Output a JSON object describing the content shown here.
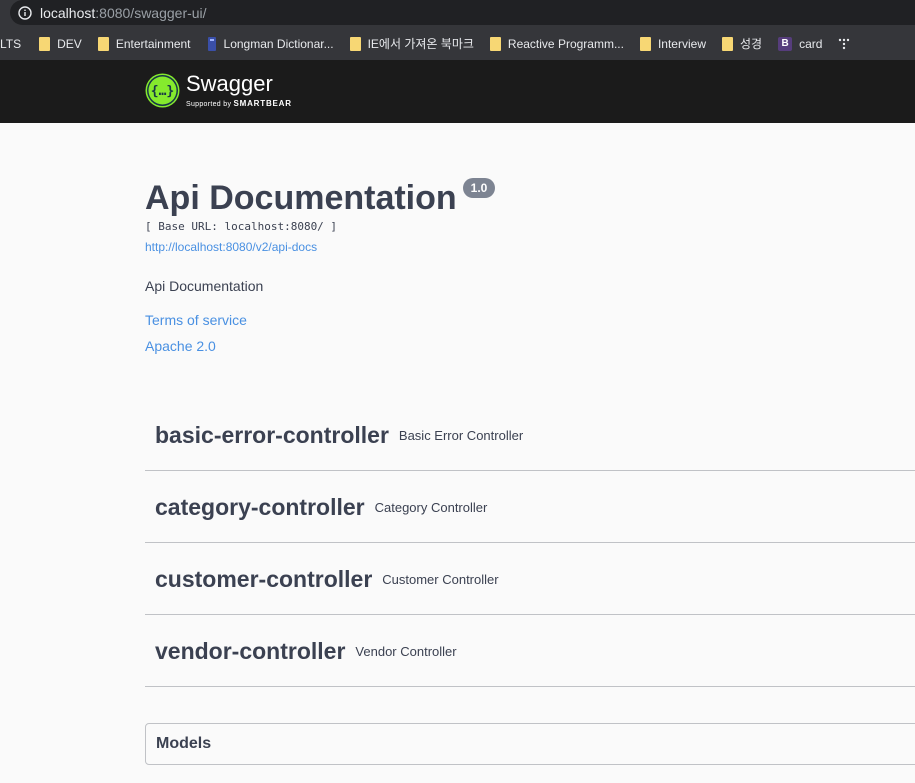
{
  "browser": {
    "url_host": "localhost",
    "url_rest": ":8080/swagger-ui/",
    "bookmarks": [
      {
        "label": "ELTS",
        "icon": "none"
      },
      {
        "label": "DEV",
        "icon": "folder-icon"
      },
      {
        "label": "Entertainment",
        "icon": "folder-icon"
      },
      {
        "label": "Longman Dictionar...",
        "icon": "longman-icon"
      },
      {
        "label": "IE에서 가져온 북마크",
        "icon": "folder-icon"
      },
      {
        "label": "Reactive Programm...",
        "icon": "folder-icon"
      },
      {
        "label": "Interview",
        "icon": "folder-icon"
      },
      {
        "label": "성경",
        "icon": "folder-icon"
      },
      {
        "label": "card",
        "icon": "bootstrap-icon"
      }
    ]
  },
  "topbar": {
    "logo_title": "Swagger",
    "logo_sub_prefix": "Supported by",
    "logo_sub_brand": "SMARTBEAR"
  },
  "info": {
    "title": "Api Documentation",
    "version": "1.0",
    "base_url": "[ Base URL: localhost:8080/ ]",
    "spec_link": "http://localhost:8080/v2/api-docs",
    "description": "Api Documentation",
    "terms": "Terms of service",
    "license": "Apache 2.0"
  },
  "tags": [
    {
      "name": "basic-error-controller",
      "description": "Basic Error Controller"
    },
    {
      "name": "category-controller",
      "description": "Category Controller"
    },
    {
      "name": "customer-controller",
      "description": "Customer Controller"
    },
    {
      "name": "vendor-controller",
      "description": "Vendor Controller"
    }
  ],
  "models": {
    "title": "Models"
  },
  "colors": {
    "link": "#4990e2",
    "text": "#3b4151",
    "logo_green": "#85ea2d",
    "topbar": "#1b1b1b"
  }
}
